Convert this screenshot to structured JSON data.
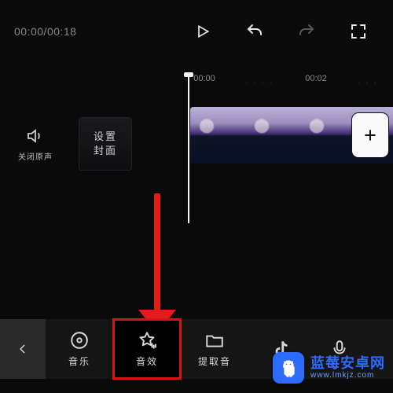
{
  "timecode": {
    "current": "00:00",
    "total": "00:18"
  },
  "ruler": {
    "t0": "00:00",
    "t1": "00:02"
  },
  "muteLabel": "关闭原声",
  "coverTile": {
    "line1": "设置",
    "line2": "封面"
  },
  "tools": {
    "music": {
      "label": "音乐"
    },
    "sfx": {
      "label": "音效"
    },
    "extract": {
      "label": "提取音"
    }
  },
  "watermark": {
    "title": "蓝莓安卓网",
    "url": "www.lmkjz.com"
  }
}
